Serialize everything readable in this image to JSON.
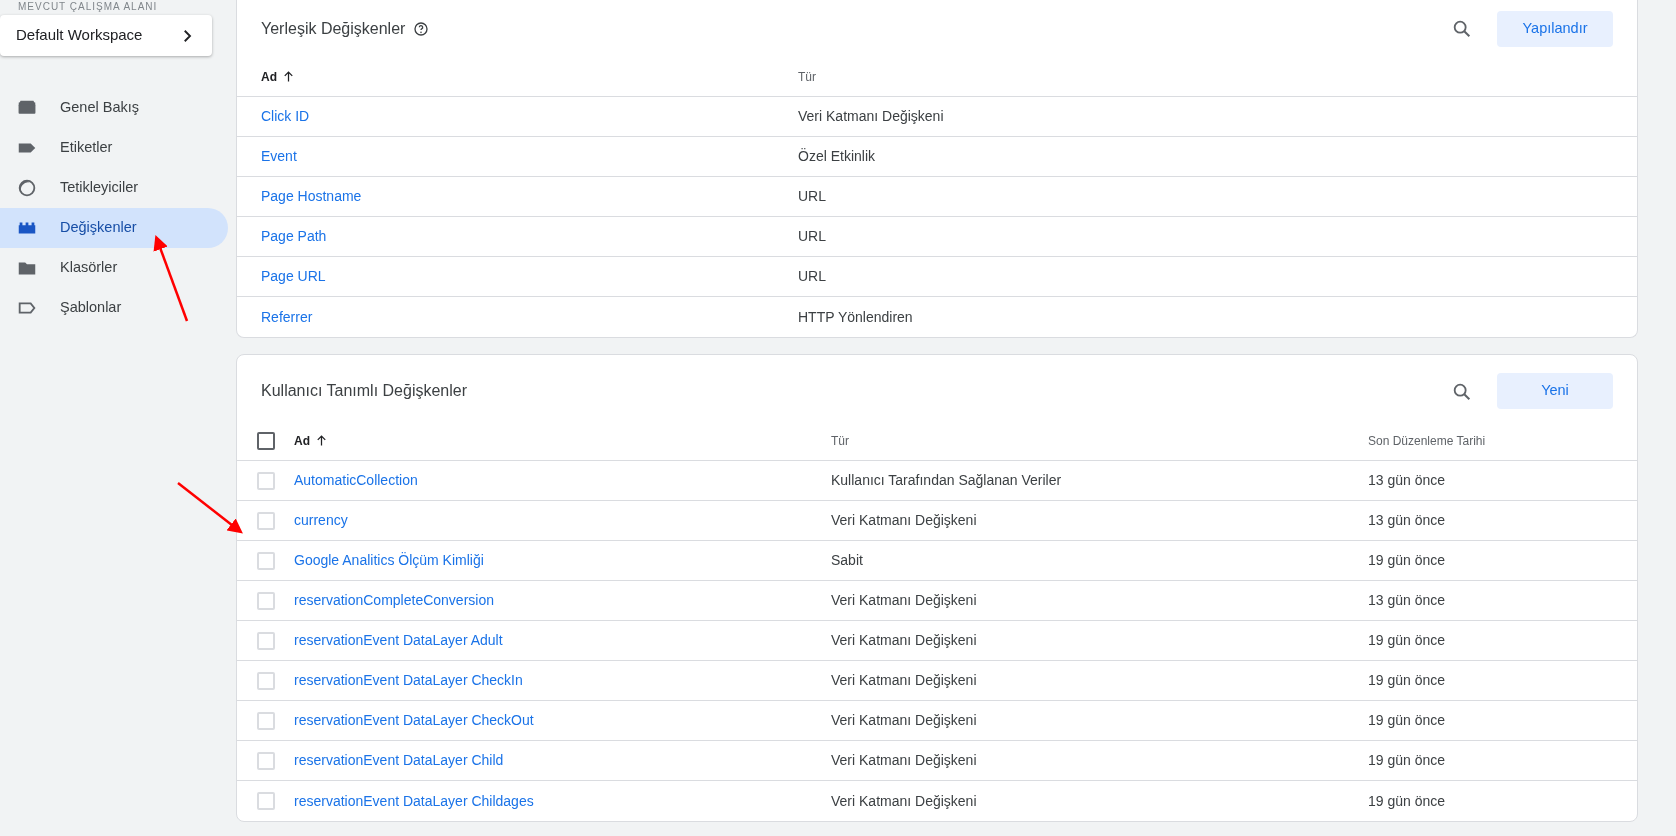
{
  "sidebar": {
    "workspace_label": "MEVCUT ÇALIŞMA ALANI",
    "workspace": "Default Workspace",
    "items": [
      {
        "label": "Genel Bakış",
        "kind": "overview",
        "selected": false
      },
      {
        "label": "Etiketler",
        "kind": "tags",
        "selected": false
      },
      {
        "label": "Tetikleyiciler",
        "kind": "triggers",
        "selected": false
      },
      {
        "label": "Değişkenler",
        "kind": "variables",
        "selected": true
      },
      {
        "label": "Klasörler",
        "kind": "folders",
        "selected": false
      },
      {
        "label": "Şablonlar",
        "kind": "templates",
        "selected": false
      }
    ]
  },
  "builtin": {
    "title": "Yerleşik Değişkenler",
    "button": "Yapılandır",
    "columns": [
      "Ad",
      "Tür"
    ],
    "rows": [
      {
        "name": "Click ID",
        "type": "Veri Katmanı Değişkeni"
      },
      {
        "name": "Event",
        "type": "Özel Etkinlik"
      },
      {
        "name": "Page Hostname",
        "type": "URL"
      },
      {
        "name": "Page Path",
        "type": "URL"
      },
      {
        "name": "Page URL",
        "type": "URL"
      },
      {
        "name": "Referrer",
        "type": "HTTP Yönlendiren"
      }
    ]
  },
  "user": {
    "title": "Kullanıcı Tanımlı Değişkenler",
    "button": "Yeni",
    "columns": [
      "Ad",
      "Tür",
      "Son Düzenleme Tarihi"
    ],
    "select_all_checked": false,
    "rows": [
      {
        "name": "AutomaticCollection",
        "type": "Kullanıcı Tarafından Sağlanan Veriler",
        "edited": "13 gün önce",
        "checked": false
      },
      {
        "name": "currency",
        "type": "Veri Katmanı Değişkeni",
        "edited": "13 gün önce",
        "checked": false
      },
      {
        "name": "Google Analitics Ölçüm Kimliği",
        "type": "Sabit",
        "edited": "19 gün önce",
        "checked": false
      },
      {
        "name": "reservationCompleteConversion",
        "type": "Veri Katmanı Değişkeni",
        "edited": "13 gün önce",
        "checked": false
      },
      {
        "name": "reservationEvent DataLayer Adult",
        "type": "Veri Katmanı Değişkeni",
        "edited": "19 gün önce",
        "checked": false
      },
      {
        "name": "reservationEvent DataLayer CheckIn",
        "type": "Veri Katmanı Değişkeni",
        "edited": "19 gün önce",
        "checked": false
      },
      {
        "name": "reservationEvent DataLayer CheckOut",
        "type": "Veri Katmanı Değişkeni",
        "edited": "19 gün önce",
        "checked": false
      },
      {
        "name": "reservationEvent DataLayer Child",
        "type": "Veri Katmanı Değişkeni",
        "edited": "19 gün önce",
        "checked": false
      },
      {
        "name": "reservationEvent DataLayer Childages",
        "type": "Veri Katmanı Değişkeni",
        "edited": "19 gün önce",
        "checked": false
      }
    ]
  }
}
